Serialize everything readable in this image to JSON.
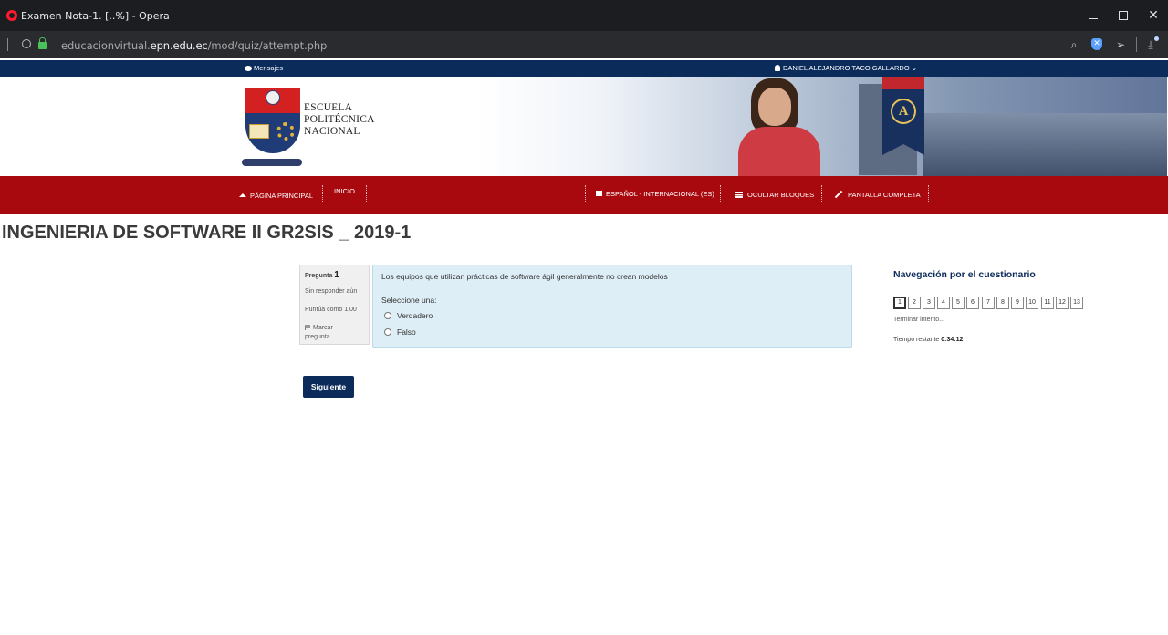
{
  "browser": {
    "window_title": "Examen Nota-1. [..%] - Opera",
    "url_prefix": "educacionvirtual.",
    "url_domain": "epn.edu.ec",
    "url_path": "/mod/quiz/attempt.php"
  },
  "topbar": {
    "messages_label": "Mensajes",
    "user_name": "DANIEL ALEJANDRO TACO GALLARDO"
  },
  "logo": {
    "line1": "ESCUELA",
    "line2": "POLITÉCNICA",
    "line3": "NACIONAL",
    "seal_letter": "A"
  },
  "nav": {
    "home": "PÁGINA PRINCIPAL",
    "inicio": "INICIO",
    "language": "ESPAÑOL - INTERNACIONAL (ES)",
    "hide_blocks": "OCULTAR BLOQUES",
    "fullscreen": "PANTALLA COMPLETA"
  },
  "course_title": "INGENIERIA DE SOFTWARE II GR2SIS _ 2019-1",
  "question": {
    "label": "Pregunta",
    "number": "1",
    "status": "Sin responder aún",
    "score": "Puntúa como 1,00",
    "flag_line1": "Marcar",
    "flag_line2": "pregunta",
    "text": "Los equipos que utilizan prácticas de software ágil generalmente no crean modelos",
    "prompt": "Seleccione una:",
    "options": [
      "Verdadero",
      "Falso"
    ]
  },
  "next_button": "Siguiente",
  "quiz_nav": {
    "title": "Navegación por el cuestionario",
    "buttons": [
      "1",
      "2",
      "3",
      "4",
      "5",
      "6",
      "7",
      "8",
      "9",
      "10",
      "11",
      "12",
      "13"
    ],
    "finish": "Terminar intento...",
    "time_label": "Tiempo restante",
    "time_value": "0:34:12"
  },
  "colors": {
    "navy": "#0b2b5b",
    "red": "#a8090f",
    "question_bg": "#ddeef6"
  }
}
